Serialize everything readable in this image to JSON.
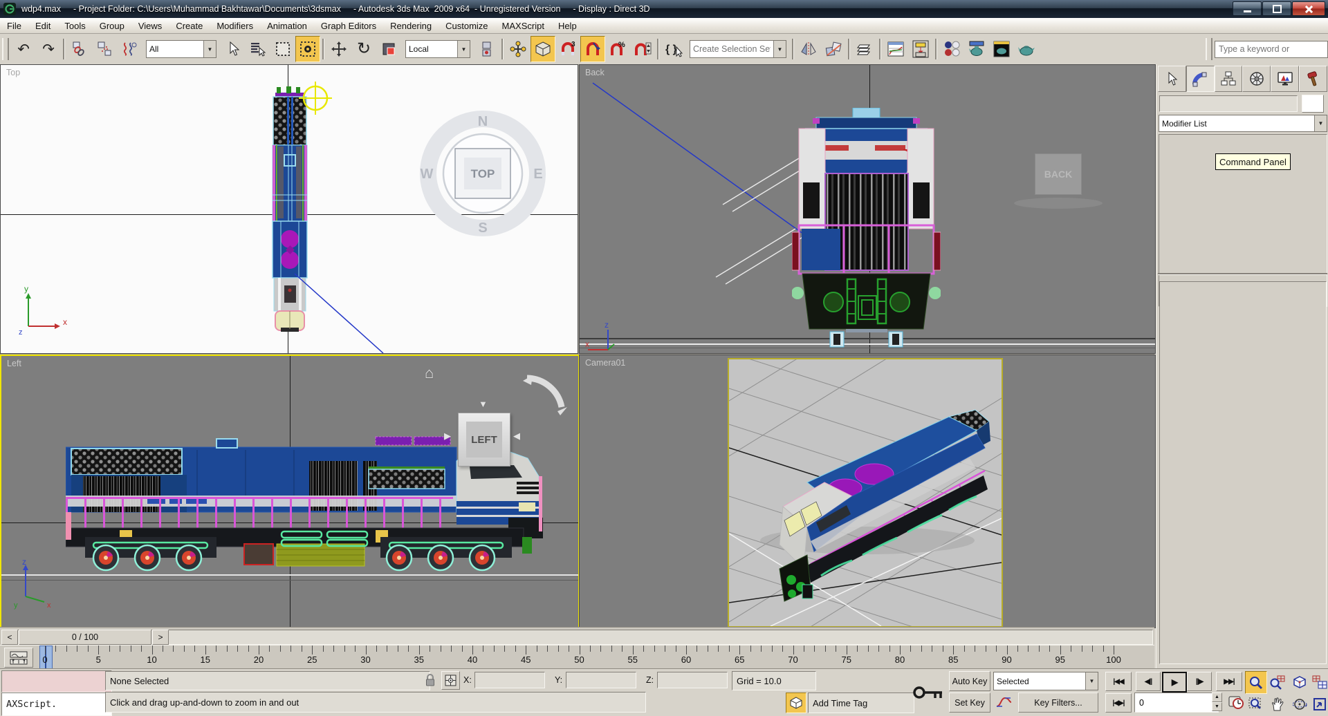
{
  "window": {
    "icon": "3ds-max-logo",
    "file": "wdp4.max",
    "project": "- Project Folder: C:\\Users\\Muhammad Bakhtawar\\Documents\\3dsmax",
    "app": "- Autodesk 3ds Max  2009 x64  - Unregistered Version",
    "display": "- Display : Direct 3D"
  },
  "menu": {
    "items": [
      "File",
      "Edit",
      "Tools",
      "Group",
      "Views",
      "Create",
      "Modifiers",
      "Animation",
      "Graph Editors",
      "Rendering",
      "Customize",
      "MAXScript",
      "Help"
    ]
  },
  "toolbar": {
    "filter_value": "All",
    "coord_value": "Local",
    "named_sets_placeholder": "Create Selection Set",
    "search_placeholder": "Type a keyword or"
  },
  "glyphs": {
    "undo": "↶",
    "redo": "↷",
    "rotate": "↻",
    "dropdown": "▼",
    "spin_up": "▲",
    "spin_down": "▼",
    "go_start": "|◀◀",
    "step_back": "◀||",
    "play": "▶",
    "step_fwd": "||▶",
    "go_end": "▶▶|",
    "key_mode": "|◀▶|",
    "braces": "{ }",
    "home": "⌂",
    "snap_3": "3",
    "percent": "%",
    "tri_down": "▼",
    "tri_left": "◀",
    "tri_right": "▶"
  },
  "viewports": {
    "top": {
      "label": "Top",
      "cube": "TOP",
      "compass": {
        "n": "N",
        "e": "E",
        "s": "S",
        "w": "W"
      }
    },
    "back": {
      "label": "Back",
      "cube": "BACK"
    },
    "left": {
      "label": "Left",
      "cube": "LEFT"
    },
    "camera": {
      "label": "Camera01"
    },
    "axis": {
      "x": "x",
      "y": "y",
      "z": "z"
    }
  },
  "timeline": {
    "slider": "0 / 100",
    "left_arrow": "<",
    "right_arrow": ">",
    "labels": [
      0,
      5,
      10,
      15,
      20,
      25,
      30,
      35,
      40,
      45,
      50,
      55,
      60,
      65,
      70,
      75,
      80,
      85,
      90,
      95,
      100
    ],
    "frames": 100
  },
  "status": {
    "maxscript": "AXScript.",
    "selection": "None Selected",
    "prompt": "Click and drag up-and-down to zoom in and out",
    "x_label": "X:",
    "y_label": "Y:",
    "z_label": "Z:",
    "x_value": "",
    "y_value": "",
    "z_value": "",
    "grid": "Grid = 10.0",
    "add_time_tag": "Add Time Tag",
    "auto_key": "Auto Key",
    "set_key": "Set Key",
    "key_filter_value": "Selected",
    "key_filters": "Key Filters...",
    "frame": "0"
  },
  "panel": {
    "modifier_list": "Modifier List",
    "tooltip": "Command Panel"
  },
  "colors": {
    "accent_yellow": "#f3c64f",
    "active_border": "#f0e600",
    "viewport_gray": "#7e7e7e",
    "body_blue": "#1c4896",
    "rail_magenta": "#d955d9"
  }
}
